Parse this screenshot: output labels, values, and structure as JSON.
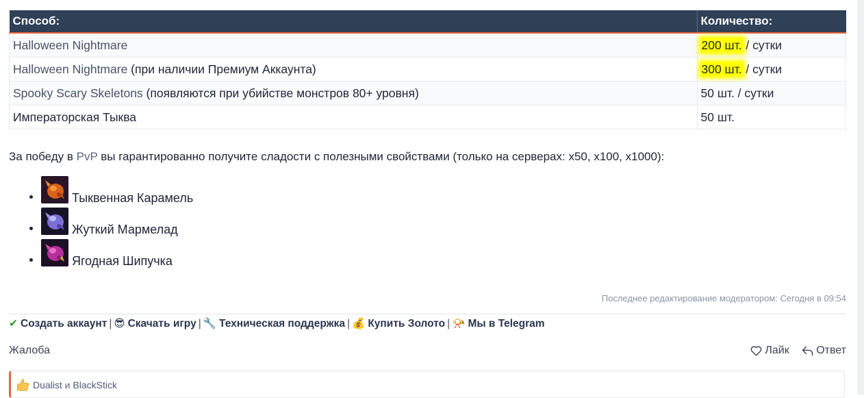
{
  "table": {
    "headers": [
      "Способ:",
      "Количество:"
    ],
    "rows": [
      {
        "method": "Halloween Nightmare",
        "method_extra": "",
        "amount": "200 шт.",
        "per": " / сутки"
      },
      {
        "method": "Halloween Nightmare",
        "method_extra": " (при наличии Премиум Аккаунта)",
        "amount": "300 шт.",
        "per": " / сутки"
      },
      {
        "method": "Spooky Scary Skeletons",
        "method_extra": " (появляются при убийстве монстров 80+ уровня)",
        "amount": "50 шт.",
        "per": " / сутки"
      },
      {
        "method": "Императорская Тыква",
        "method_extra": "",
        "amount": "50 шт.",
        "per": ""
      }
    ]
  },
  "pvp": {
    "prefix": "За победу в ",
    "link": "PvP",
    "suffix": " вы гарантированно получите сладости с полезными свойствами (только на серверах: x50, x100, x1000):"
  },
  "candies": [
    {
      "label": "Тыквенная Карамель",
      "icon": "pumpkin-caramel-icon"
    },
    {
      "label": "Жуткий Мармелад",
      "icon": "creepy-marmalade-icon"
    },
    {
      "label": "Ягодная Шипучка",
      "icon": "berry-fizz-icon"
    }
  ],
  "edit_note": "Последнее редактирование модератором: Сегодня в 09:54",
  "signature": [
    {
      "emoji": "✔",
      "label": "Создать аккаунт",
      "icon": "check-icon"
    },
    {
      "emoji": "😎",
      "label": "Скачать игру",
      "icon": "sunglasses-icon"
    },
    {
      "emoji": "🔧",
      "label": "Техническая поддержка",
      "icon": "wrench-icon"
    },
    {
      "emoji": "💰",
      "label": "Купить Золото",
      "icon": "money-bag-icon"
    },
    {
      "emoji": "📯",
      "label": "Мы в Telegram",
      "icon": "horn-icon"
    }
  ],
  "signature_separator": "|",
  "footer": {
    "report": "Жалоба",
    "like": "Лайк",
    "reply": "Ответ"
  },
  "likes": {
    "user1": "Dualist",
    "conj": " и ",
    "user2": "BlackStick"
  },
  "colors": {
    "header_bg": "#2f4057",
    "accent": "#e5643a",
    "highlight": "#ffff00"
  }
}
